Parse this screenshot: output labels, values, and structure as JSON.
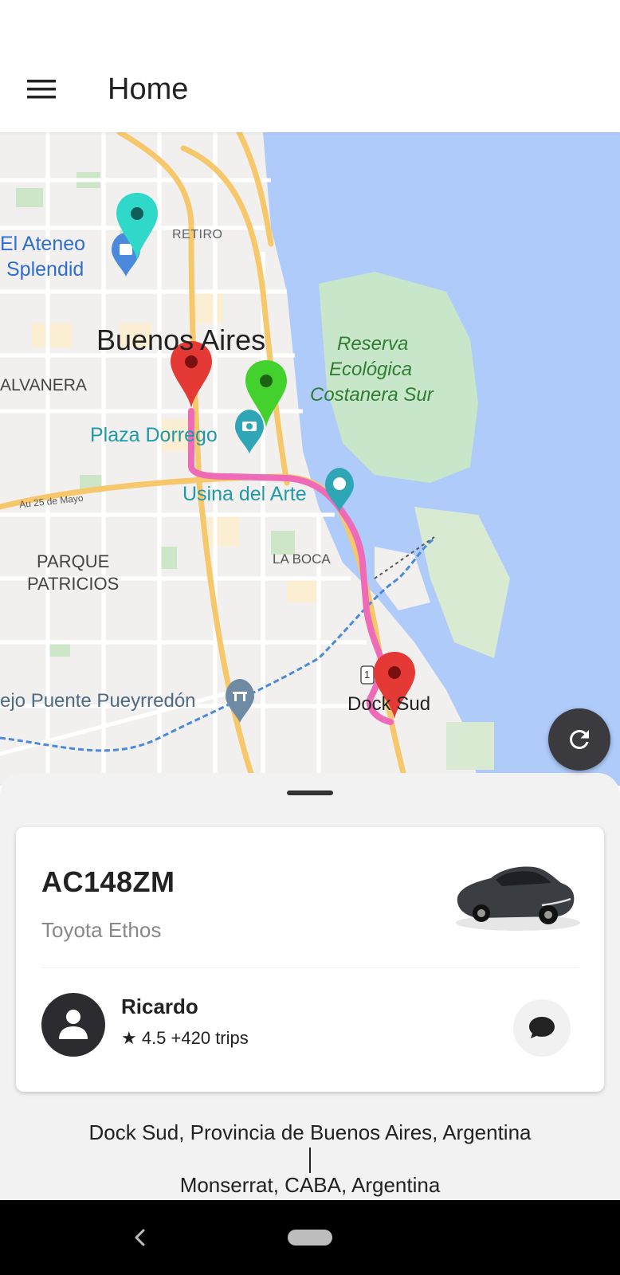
{
  "app_bar": {
    "title": "Home",
    "menu_icon": "hamburger-menu-icon"
  },
  "map": {
    "labels": {
      "retiro": "RETIRO",
      "ateneo_line1": "El Ateneo",
      "ateneo_line2": "Splendid",
      "buenos_aires": "Buenos Aires",
      "balvanera": "ALVANERA",
      "reserva_line1": "Reserva",
      "reserva_line2": "Ecológica",
      "reserva_line3": "Costanera Sur",
      "plaza_dorrego": "Plaza Dorrego",
      "usina": "Usina del Arte",
      "au25": "Au 25 de Mayo",
      "parque_line1": "PARQUE",
      "parque_line2": "PATRICIOS",
      "la_boca": "LA BOCA",
      "puente": "ejo Puente Pueyrredón",
      "dock_sud": "Dock Sud",
      "route_shield": "1"
    },
    "colors": {
      "water": "#aecbfa",
      "land": "#f1f0ee",
      "park": "#c8e6c9",
      "road": "#f6c86b",
      "route": "#f06bb7",
      "pin_red": "#e53935",
      "pin_green": "#43d12e",
      "pin_teal": "#2fd8c9"
    },
    "refresh_icon": "refresh-icon"
  },
  "trip": {
    "plate": "AC148ZM",
    "car_model": "Toyota Ethos",
    "driver": {
      "name": "Ricardo",
      "stats": "★ 4.5 +420 trips",
      "avatar_icon": "person-icon"
    },
    "chat_icon": "chat-bubble-icon",
    "from_address": "Dock Sud, Provincia de Buenos Aires, Argentina",
    "to_address": "Monserrat, CABA, Argentina"
  },
  "nav": {
    "back_icon": "back-chevron-icon",
    "home_icon": "home-pill-icon"
  }
}
